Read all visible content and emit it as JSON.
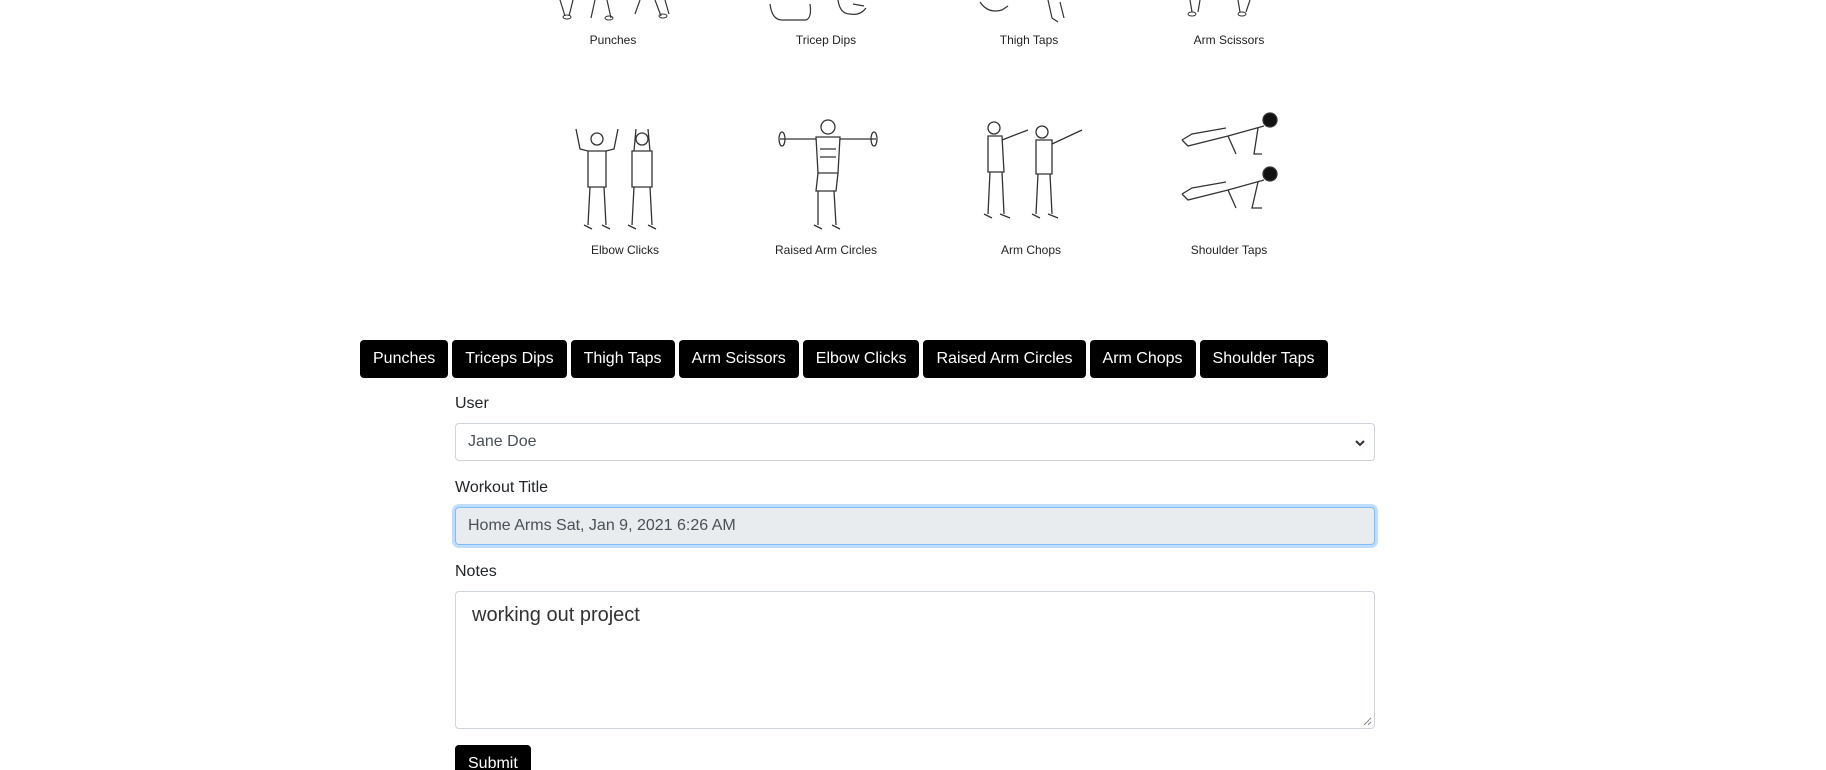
{
  "exercises_top": [
    {
      "caption": "Punches"
    },
    {
      "caption": "Tricep Dips"
    },
    {
      "caption": "Thigh Taps"
    },
    {
      "caption": "Arm Scissors"
    }
  ],
  "exercises_bottom": [
    {
      "caption": "Elbow Clicks"
    },
    {
      "caption": "Raised Arm Circles"
    },
    {
      "caption": "Arm Chops"
    },
    {
      "caption": "Shoulder Taps"
    }
  ],
  "buttons": [
    "Punches",
    "Triceps Dips",
    "Thigh Taps",
    "Arm Scissors",
    "Elbow Clicks",
    "Raised Arm Circles",
    "Arm Chops",
    "Shoulder Taps"
  ],
  "form": {
    "user_label": "User",
    "user_value": "Jane Doe",
    "title_label": "Workout Title",
    "title_value": "Home Arms Sat, Jan 9, 2021 6:26 AM",
    "notes_label": "Notes",
    "notes_value": "working out project",
    "submit_label": "Submit"
  },
  "colors": {
    "button_bg": "#000000",
    "button_text": "#ffffff",
    "focus_ring": "#80bdff",
    "input_disabled_bg": "#e9ecef"
  }
}
